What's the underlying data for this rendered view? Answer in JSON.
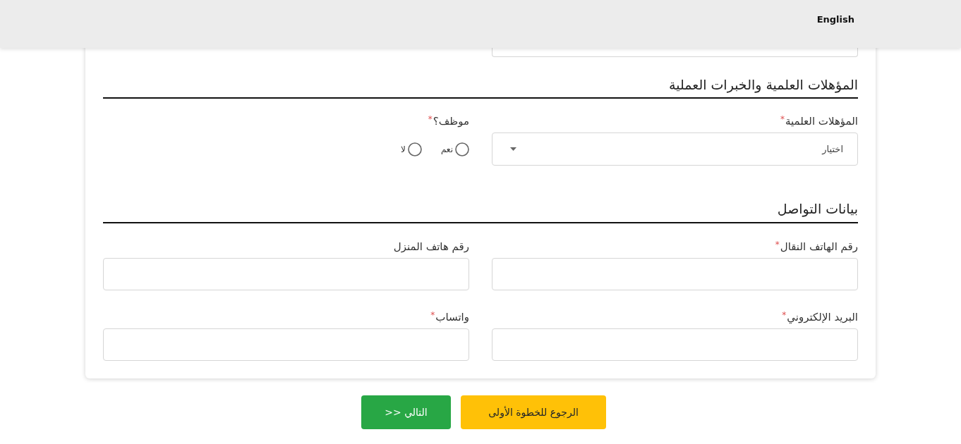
{
  "header": {
    "language_link": "English"
  },
  "sections": [
    {
      "title": "المؤهلات العلمية والخبرات العملية",
      "fields": [
        {
          "kind": "select",
          "label": "المؤهلات العلمية",
          "required_mark": "*",
          "placeholder": "اختيار"
        },
        {
          "kind": "radio",
          "label": "موظف؟",
          "required_mark": "*",
          "options": [
            {
              "label": "نعم",
              "selected": false
            },
            {
              "label": "لا",
              "selected": false
            }
          ]
        }
      ]
    },
    {
      "title": "بيانات التواصل",
      "fields": [
        {
          "kind": "text",
          "label": "رقم الهاتف النقال",
          "required_mark": "*"
        },
        {
          "kind": "text",
          "label": "رقم هاتف المنزل"
        },
        {
          "kind": "text",
          "label": "البريد الإلكتروني",
          "required_mark": "*"
        },
        {
          "kind": "text",
          "label": "واتساب",
          "required_mark": "*"
        }
      ]
    }
  ],
  "buttons": [
    {
      "kind": "secondary",
      "label": "الرجوع للخطوة الأولى"
    },
    {
      "kind": "primary",
      "label": ">> التالي"
    }
  ]
}
